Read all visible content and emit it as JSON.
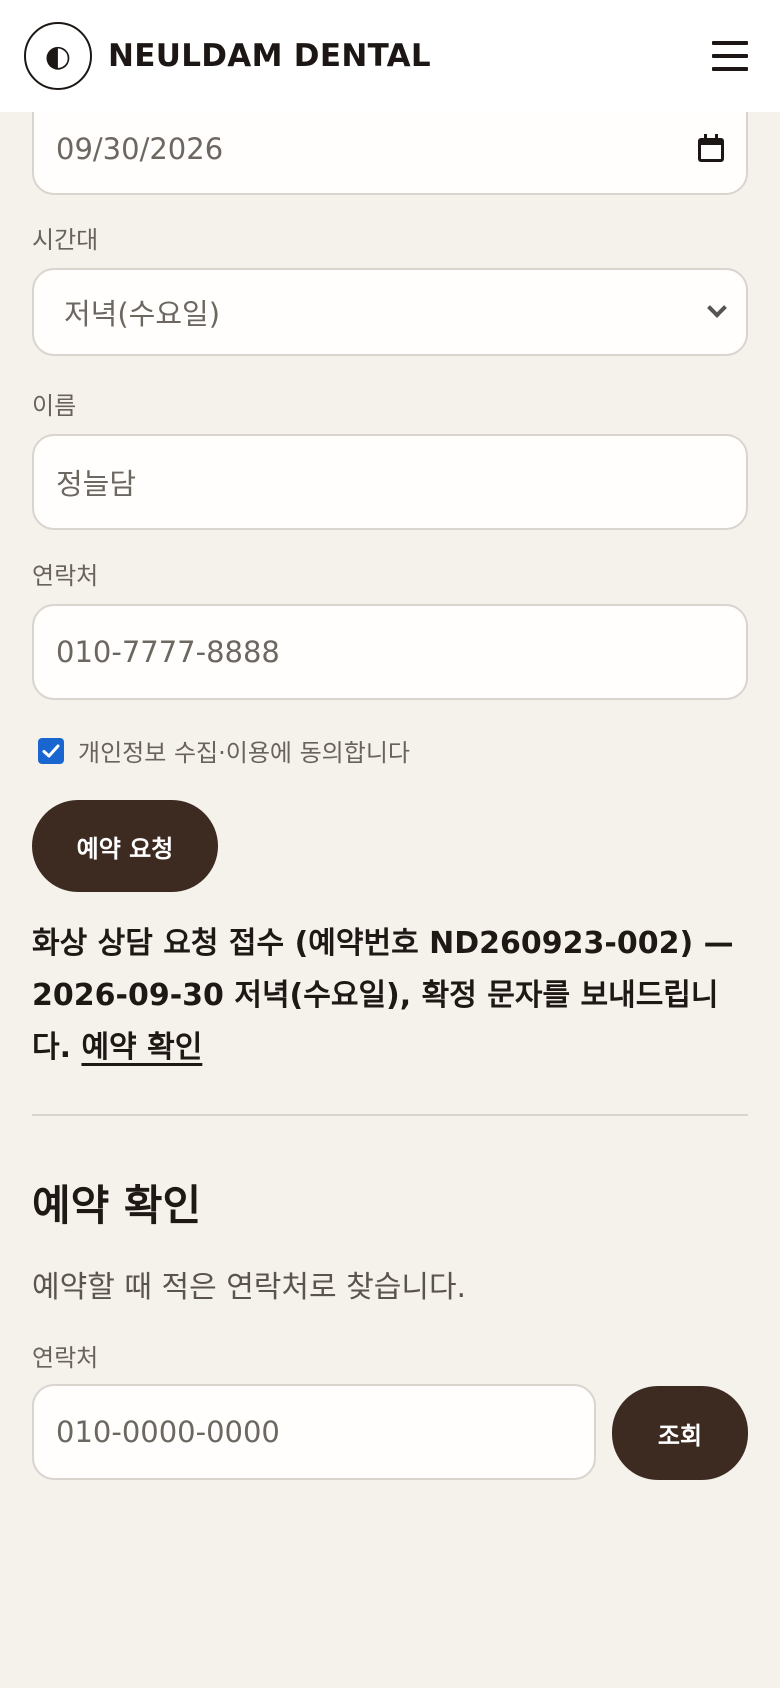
{
  "header": {
    "logo_glyph": "◐",
    "brand": "NEULDAM DENTAL"
  },
  "form": {
    "date_value": "09/30/2026",
    "time_label": "시간대",
    "time_value": "저녁(수요일)",
    "name_label": "이름",
    "name_value": "정늘담",
    "phone_label": "연락처",
    "phone_value": "010-7777-8888",
    "consent_text": "개인정보 수집·이용에 동의합니다",
    "consent_checked": true,
    "submit_label": "예약 요청"
  },
  "result": {
    "message": "화상 상담 요청 접수 (예약번호 ND260923-002) — 2026-09-30 저녁(수요일), 확정 문자를 보내드립니다. ",
    "link_text": "예약 확인"
  },
  "lookup": {
    "title": "예약 확인",
    "description": "예약할 때 적은 연락처로 찾습니다.",
    "phone_label": "연락처",
    "phone_placeholder": "010-0000-0000",
    "search_label": "조회"
  },
  "colors": {
    "background": "#f5f1eb",
    "button": "#3d2b22",
    "checkbox": "#1a66d1"
  }
}
